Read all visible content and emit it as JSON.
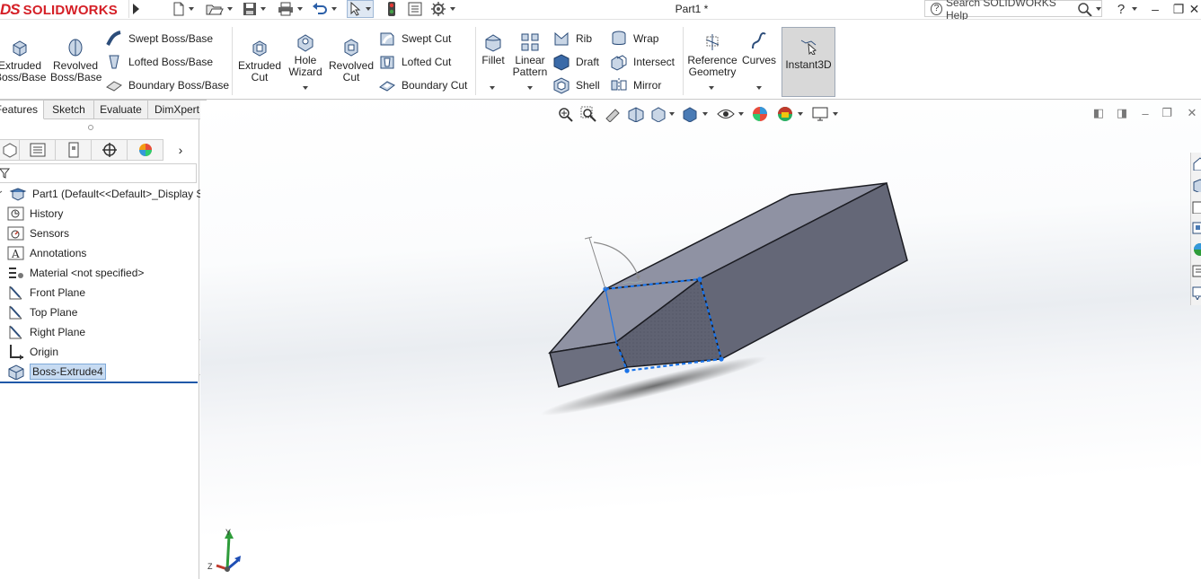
{
  "app": {
    "brand_prefix": "DS",
    "brand": "SOLIDWORKS",
    "doc_title": "Part1 *",
    "search_placeholder": "Search SOLIDWORKS Help"
  },
  "toolbar": {
    "extruded_boss": "Extruded Boss/Base",
    "revolved_boss": "Revolved Boss/Base",
    "swept_boss": "Swept Boss/Base",
    "lofted_boss": "Lofted Boss/Base",
    "boundary_boss": "Boundary Boss/Base",
    "extruded_cut": "Extruded Cut",
    "hole_wizard": "Hole Wizard",
    "revolved_cut": "Revolved Cut",
    "swept_cut": "Swept Cut",
    "lofted_cut": "Lofted Cut",
    "boundary_cut": "Boundary Cut",
    "fillet": "Fillet",
    "linear_pattern": "Linear Pattern",
    "rib": "Rib",
    "draft": "Draft",
    "shell": "Shell",
    "wrap": "Wrap",
    "intersect": "Intersect",
    "mirror": "Mirror",
    "reference_geometry": "Reference Geometry",
    "curves": "Curves",
    "instant3d": "Instant3D"
  },
  "tabs": [
    "Features",
    "Sketch",
    "Evaluate",
    "DimXpert"
  ],
  "tree": {
    "root": "Part1  (Default<<Default>_Display S",
    "items": [
      "History",
      "Sensors",
      "Annotations",
      "Material <not specified>",
      "Front Plane",
      "Top Plane",
      "Right Plane",
      "Origin",
      "Boss-Extrude4"
    ]
  },
  "triad": {
    "y": "Y",
    "z": "Z"
  },
  "colors": {
    "brand_red": "#d51f26",
    "selection_blue": "#1a73e8",
    "body_gray": "#6e7180"
  }
}
